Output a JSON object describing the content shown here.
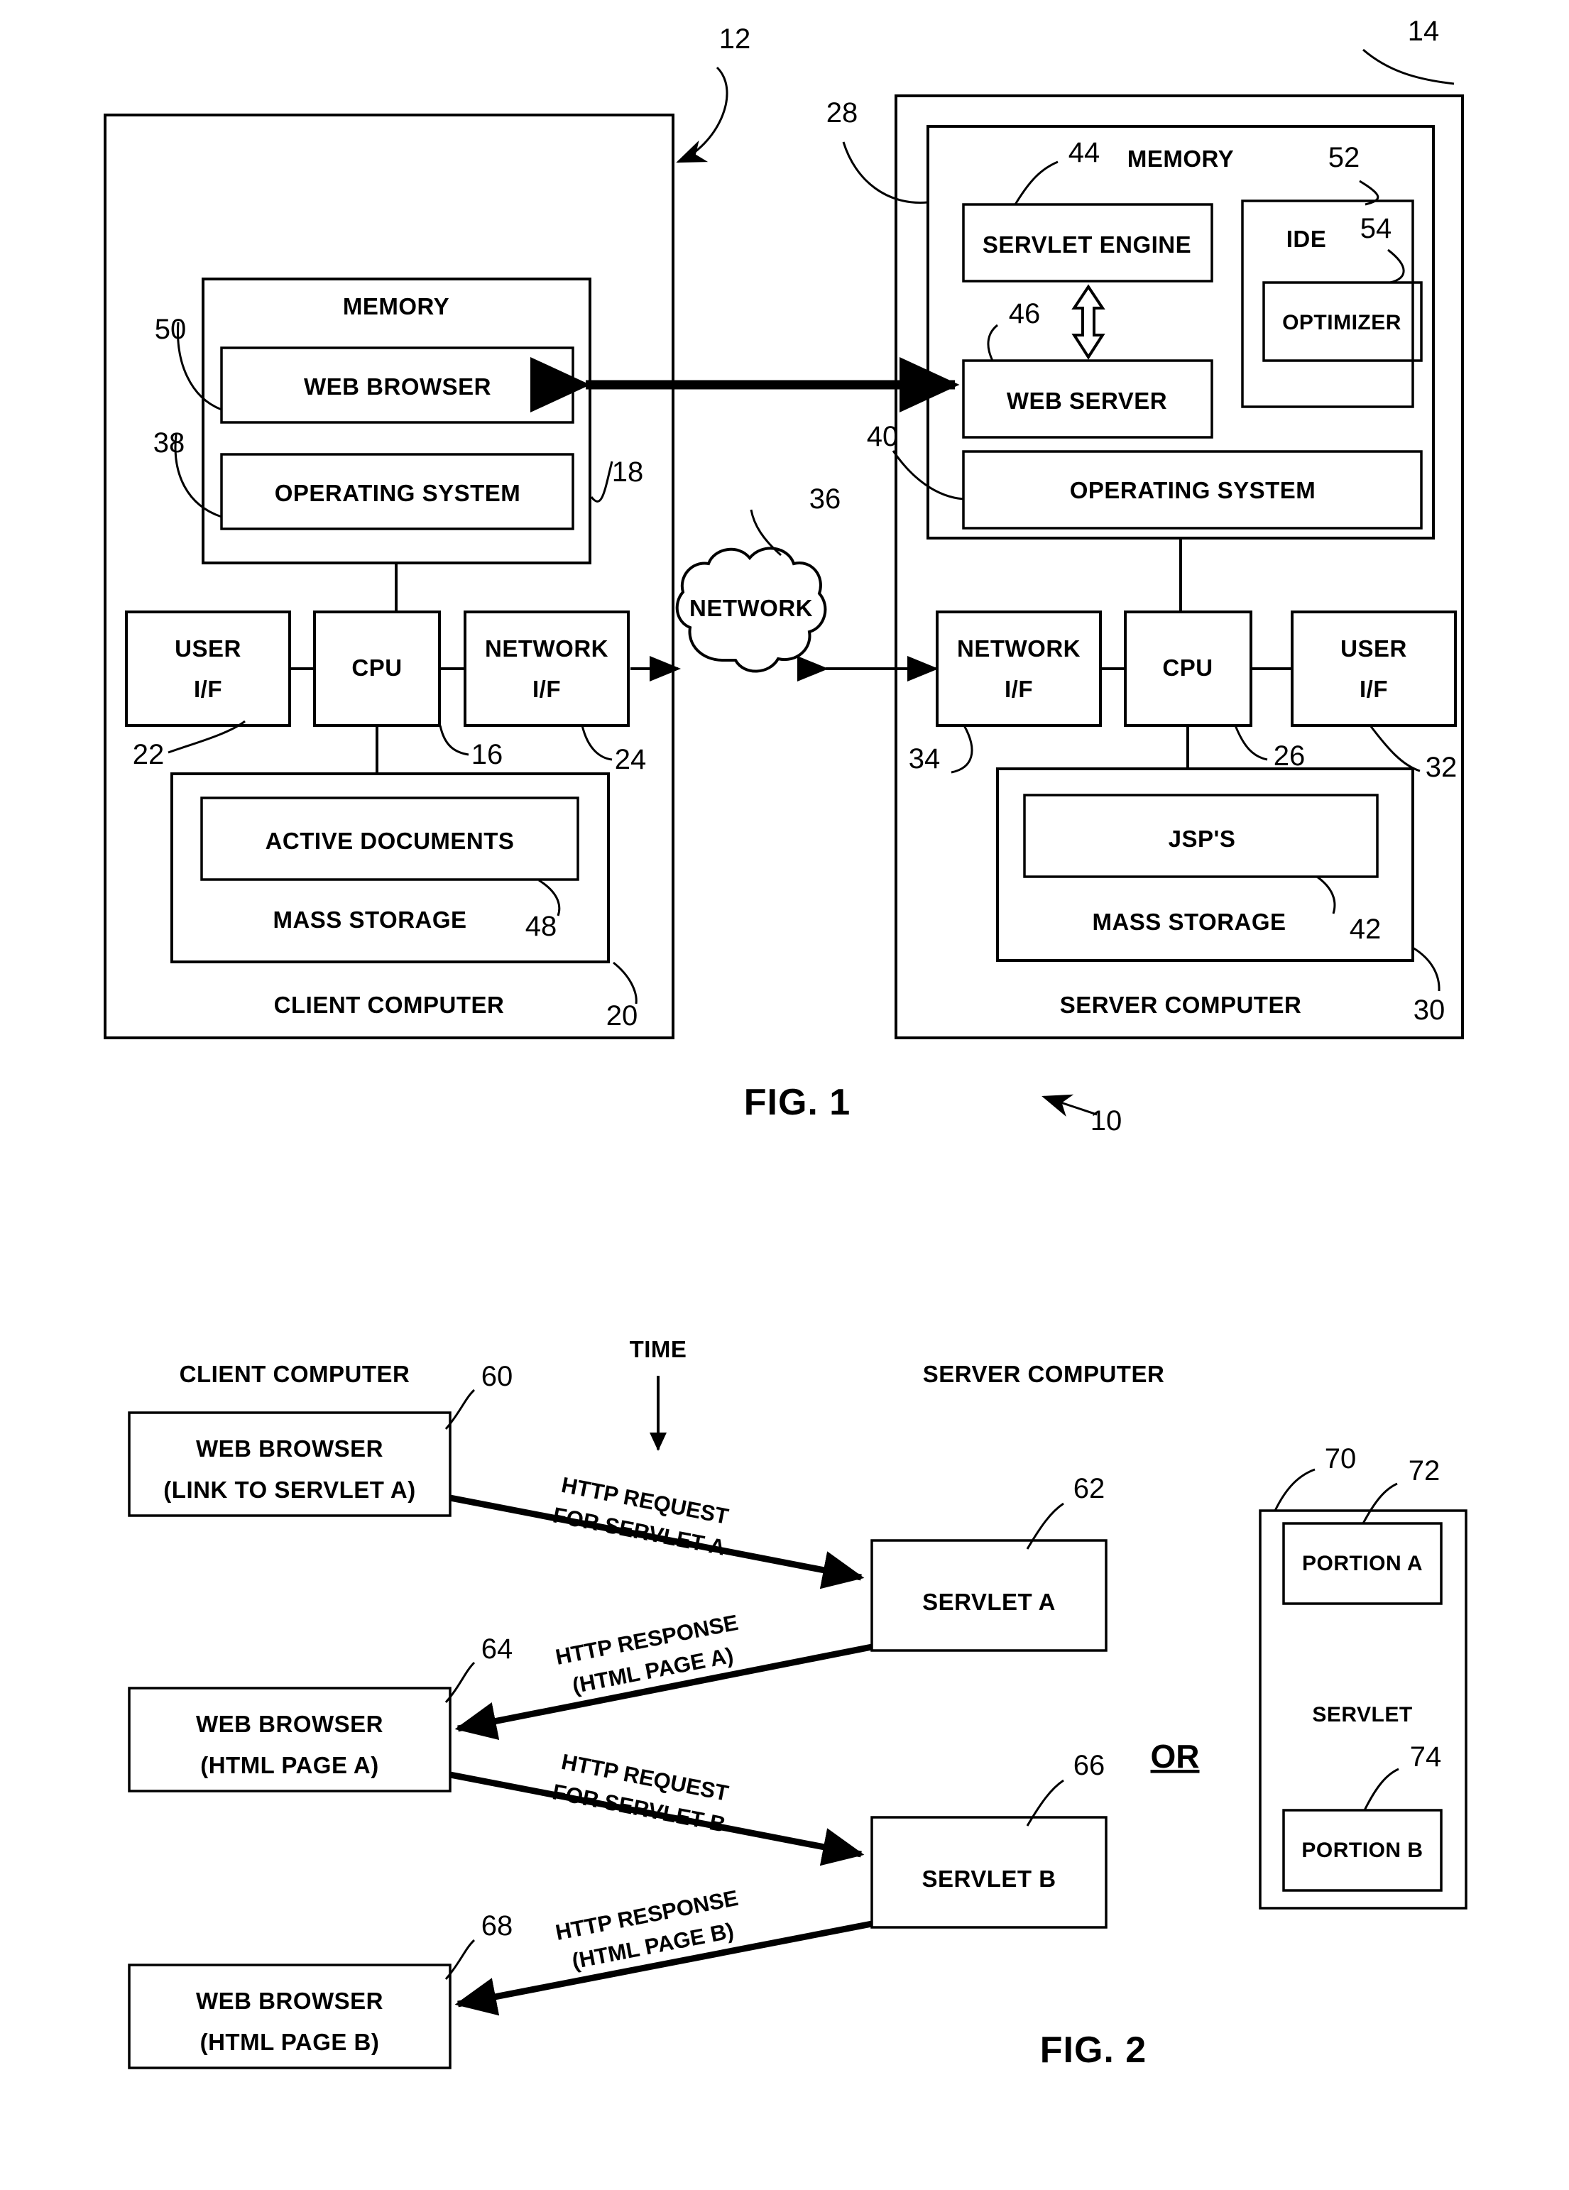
{
  "document": {
    "type": "patent-drawing-sheet",
    "figures": [
      "FIG. 1",
      "FIG. 2"
    ]
  },
  "fig1": {
    "caption": "FIG. 1",
    "system_ref": "10",
    "client": {
      "title": "CLIENT COMPUTER",
      "ref": "20",
      "bracket_ref": "12",
      "memory": {
        "title": "MEMORY",
        "ref": "18",
        "items": [
          {
            "label": "WEB BROWSER",
            "ref": "50"
          },
          {
            "label": "OPERATING SYSTEM",
            "ref": "38"
          }
        ]
      },
      "bus_items": [
        {
          "label_line1": "USER",
          "label_line2": "I/F",
          "ref": "22"
        },
        {
          "label_line1": "CPU",
          "label_line2": "",
          "ref": "16"
        },
        {
          "label_line1": "NETWORK",
          "label_line2": "I/F",
          "ref": "24"
        }
      ],
      "storage": {
        "title": "MASS STORAGE",
        "ref": "48",
        "inner_label": "ACTIVE DOCUMENTS"
      }
    },
    "network": {
      "label": "NETWORK",
      "ref": "36"
    },
    "server": {
      "title": "SERVER COMPUTER",
      "ref": "30",
      "bracket_ref": "14",
      "memory": {
        "title": "MEMORY",
        "ref": "28",
        "items": [
          {
            "label": "SERVLET ENGINE",
            "ref": "44"
          },
          {
            "label": "WEB SERVER",
            "ref": "46"
          },
          {
            "label": "OPERATING SYSTEM",
            "ref": "40"
          }
        ],
        "ide": {
          "label": "IDE",
          "ref": "52",
          "inner_label": "OPTIMIZER",
          "inner_ref": "54"
        }
      },
      "bus_items": [
        {
          "label_line1": "NETWORK",
          "label_line2": "I/F",
          "ref": "34"
        },
        {
          "label_line1": "CPU",
          "label_line2": "",
          "ref": "26"
        },
        {
          "label_line1": "USER",
          "label_line2": "I/F",
          "ref": "32"
        }
      ],
      "storage": {
        "title": "MASS STORAGE",
        "ref": "42",
        "inner_label": "JSP'S"
      }
    }
  },
  "fig2": {
    "caption": "FIG. 2",
    "column_left": "CLIENT COMPUTER",
    "column_right": "SERVER COMPUTER",
    "time_label": "TIME",
    "or_label": "OR",
    "client_states": [
      {
        "line1": "WEB BROWSER",
        "line2": "(LINK TO SERVLET A)",
        "ref": "60"
      },
      {
        "line1": "WEB BROWSER",
        "line2": "(HTML PAGE A)",
        "ref": "64"
      },
      {
        "line1": "WEB BROWSER",
        "line2": "(HTML PAGE B)",
        "ref": "68"
      }
    ],
    "servlets": [
      {
        "label": "SERVLET A",
        "ref": "62"
      },
      {
        "label": "SERVLET B",
        "ref": "66"
      }
    ],
    "messages": [
      {
        "line1": "HTTP REQUEST",
        "line2": "FOR SERVLET A"
      },
      {
        "line1": "HTTP RESPONSE",
        "line2": "(HTML PAGE A)"
      },
      {
        "line1": "HTTP REQUEST",
        "line2": "FOR SERVLET B"
      },
      {
        "line1": "HTTP RESPONSE",
        "line2": "(HTML PAGE B)"
      }
    ],
    "servlet_detail": {
      "outer_ref": "70",
      "label": "SERVLET",
      "portions": [
        {
          "label": "PORTION A",
          "ref": "72"
        },
        {
          "label": "PORTION B",
          "ref": "74"
        }
      ]
    }
  },
  "colors": {
    "ink": "#000000",
    "paper": "#ffffff"
  }
}
